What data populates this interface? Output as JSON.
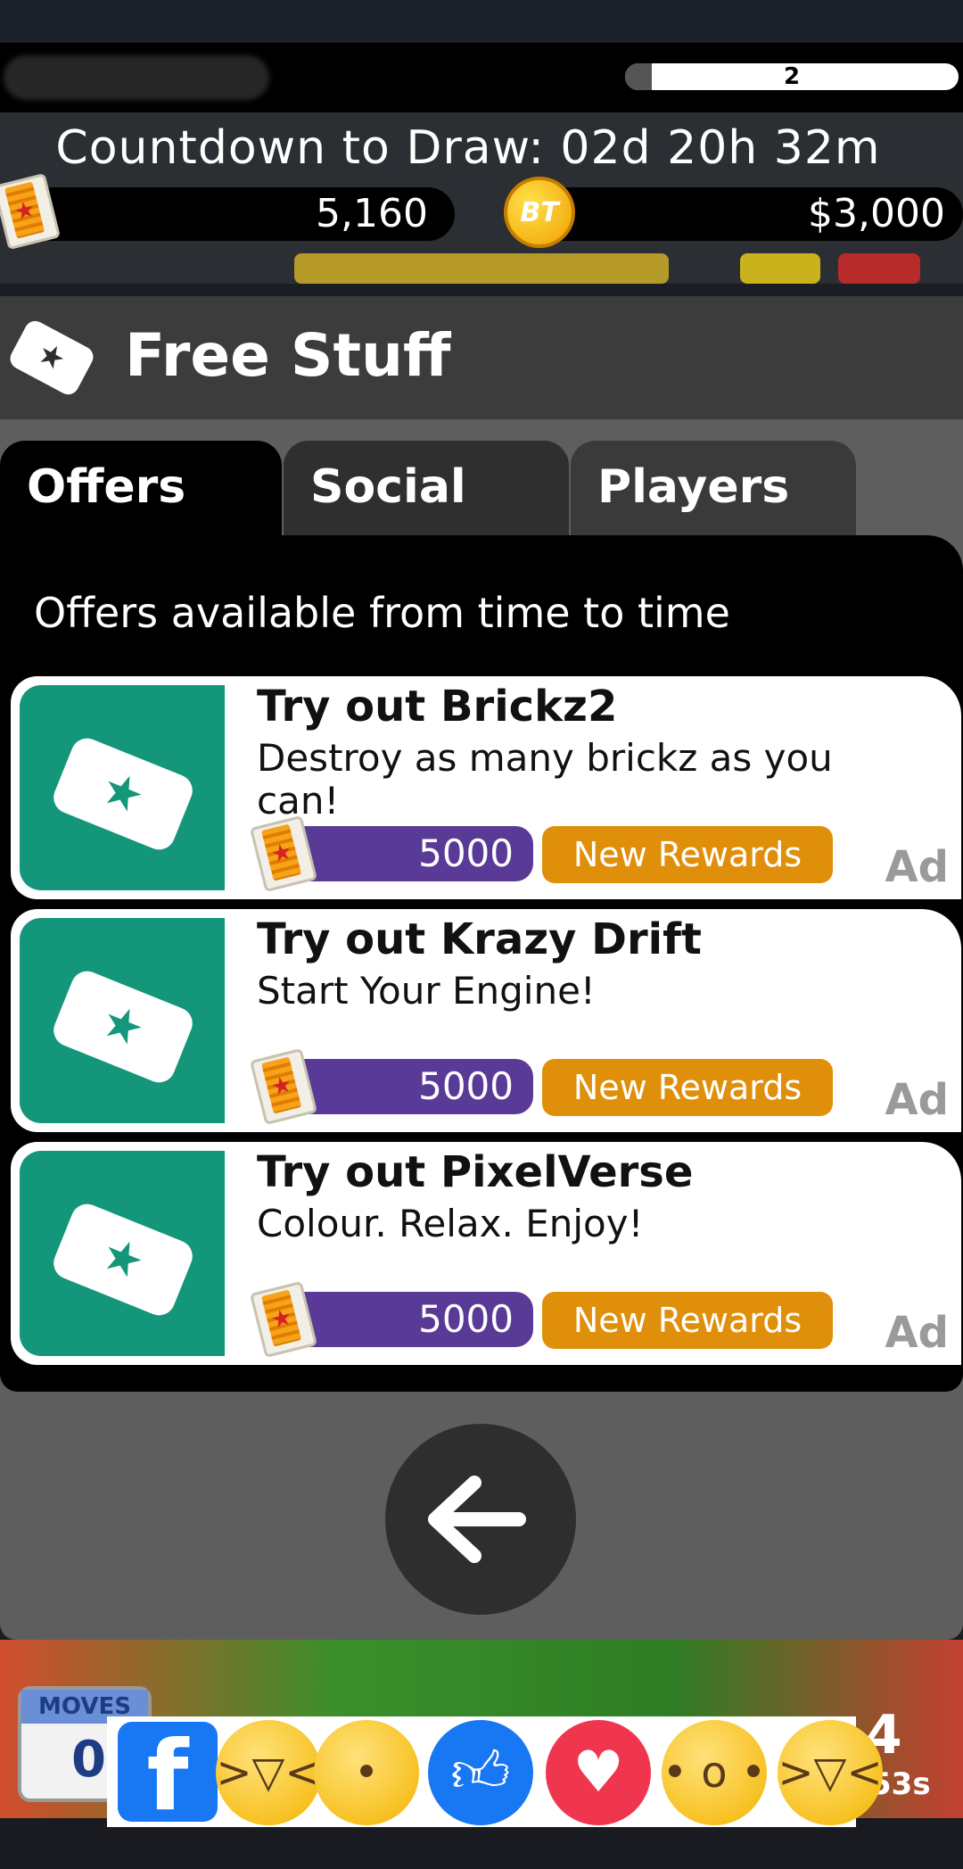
{
  "hud": {
    "level": "2",
    "level_progress": 0.08,
    "countdown": "Countdown to Draw: 02d 20h 32m",
    "tickets": "5,160",
    "coin_label": "BT",
    "cash": "$3,000"
  },
  "panel": {
    "title": "Free Stuff",
    "tabs": [
      "Offers",
      "Social",
      "Players"
    ],
    "subtitle": "Offers available from time to time",
    "offers": [
      {
        "title": "Try out Brickz2",
        "description": "Destroy as many brickz as you can!",
        "reward": "5000",
        "badge": "New Rewards",
        "ad": "Ad"
      },
      {
        "title": "Try out Krazy Drift",
        "description": "Start Your Engine!",
        "reward": "5000",
        "badge": "New Rewards",
        "ad": "Ad"
      },
      {
        "title": "Try out PixelVerse",
        "description": "Colour. Relax. Enjoy!",
        "reward": "5000",
        "badge": "New Rewards",
        "ad": "Ad"
      }
    ],
    "back_icon": "arrow-left-icon"
  },
  "game_peek": {
    "moves_label": "MOVES",
    "moves_value": "0",
    "timer_top": "4",
    "timer_bottom": "53s"
  },
  "reactions": [
    "facebook-icon",
    "laugh-icon",
    "sad-icon",
    "like-icon",
    "love-icon",
    "wow-icon",
    "laugh-icon"
  ],
  "colors": {
    "offer_thumb": "#13967a",
    "reward_pill": "#5a3a97",
    "new_rewards": "#e08f0a",
    "panel_bg": "#5e5e5e"
  }
}
